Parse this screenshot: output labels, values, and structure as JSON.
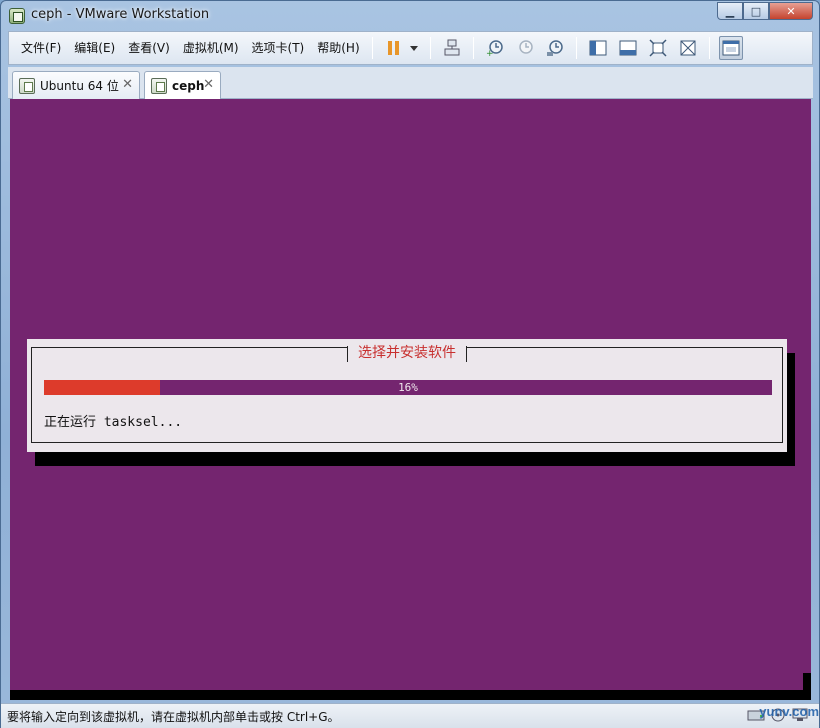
{
  "window": {
    "title": "ceph - VMware Workstation"
  },
  "menu": [
    {
      "label": "文件(F)",
      "name": "menu-file"
    },
    {
      "label": "编辑(E)",
      "name": "menu-edit"
    },
    {
      "label": "查看(V)",
      "name": "menu-view"
    },
    {
      "label": "虚拟机(M)",
      "name": "menu-vm"
    },
    {
      "label": "选项卡(T)",
      "name": "menu-tabs"
    },
    {
      "label": "帮助(H)",
      "name": "menu-help"
    }
  ],
  "tabs": [
    {
      "label": "Ubuntu 64 位",
      "active": false
    },
    {
      "label": "ceph",
      "active": true
    }
  ],
  "dialog": {
    "title": "选择并安装软件",
    "progress_percent": 16,
    "progress_label": "16%",
    "status": "正在运行 tasksel..."
  },
  "statusbar": {
    "message": "要将输入定向到该虚拟机，请在虚拟机内部单击或按 Ctrl+G。",
    "watermark": "yunv.com"
  },
  "colors": {
    "vm_background": "#74256f",
    "progress_fill": "#dd3b2b",
    "dialog_bg": "#ece7ec",
    "dialog_title": "#c8302f"
  }
}
